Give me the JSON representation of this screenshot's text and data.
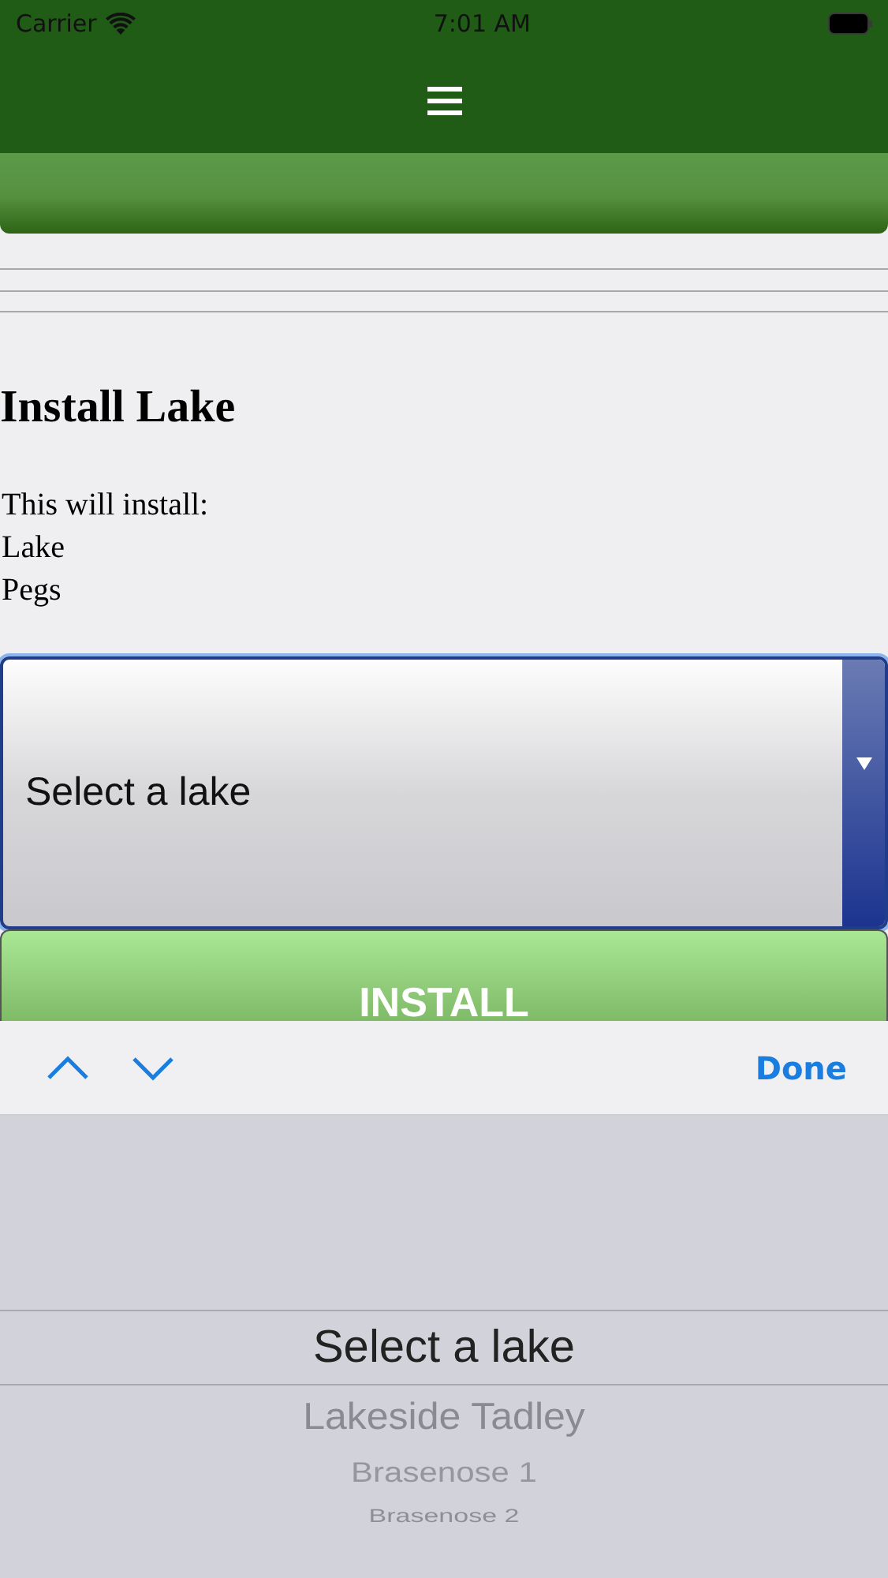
{
  "status_bar": {
    "carrier": "Carrier",
    "time": "7:01 AM"
  },
  "next_button": {
    "shown": true
  },
  "section": {
    "title": "Install Lake",
    "intro": "This will install:",
    "items": [
      "Lake",
      "Pegs"
    ]
  },
  "lake_select": {
    "value": "Select a lake",
    "focused": true
  },
  "install_button": {
    "label": "INSTALL"
  },
  "keyboard_toolbar": {
    "done": "Done"
  },
  "picker": {
    "options": [
      {
        "label": "Select a lake",
        "selected": true
      },
      {
        "label": "Lakeside Tadley",
        "selected": false
      },
      {
        "label": "Brasenose 1",
        "selected": false
      },
      {
        "label": "Brasenose 2",
        "selected": false
      }
    ]
  }
}
